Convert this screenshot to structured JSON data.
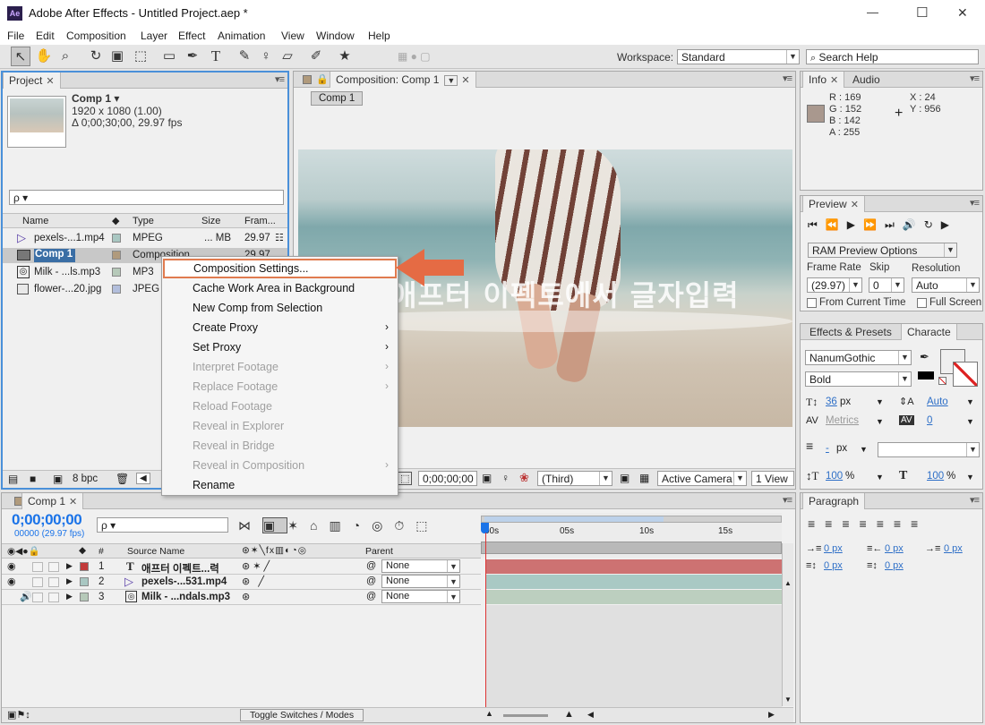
{
  "window": {
    "app_icon": "Ae",
    "title": "Adobe After Effects - Untitled Project.aep *",
    "controls": {
      "minimize": "—",
      "maximize": "☐",
      "close": "✕"
    }
  },
  "menubar": [
    "File",
    "Edit",
    "Composition",
    "Layer",
    "Effect",
    "Animation",
    "View",
    "Window",
    "Help"
  ],
  "toolbar": {
    "workspace_label": "Workspace:",
    "workspace_value": "Standard",
    "search_placeholder": "Search Help"
  },
  "project": {
    "tab": "Project",
    "comp_name": "Comp 1 ▾",
    "comp_size": "1920 x 1080 (1.00)",
    "comp_duration": "Δ 0;00;30;00, 29.97 fps",
    "search_value": "ρ ▾",
    "columns": {
      "name": "Name",
      "type": "Type",
      "size": "Size",
      "frame": "Fram..."
    },
    "items": [
      {
        "name": "pexels-...1.mp4",
        "type": "MPEG",
        "size": "... MB",
        "fps": "29.97",
        "color": "#a9c7c2",
        "icon": "video-icon"
      },
      {
        "name": "Comp 1",
        "type": "Composition",
        "size": "",
        "fps": "29.97",
        "color": "#b09a7c",
        "icon": "composition-icon"
      },
      {
        "name": "Milk - ...ls.mp3",
        "type": "MP3",
        "size": "",
        "fps": "",
        "color": "#b6c9b9",
        "icon": "audio-icon"
      },
      {
        "name": "flower-...20.jpg",
        "type": "JPEG",
        "size": "",
        "fps": "",
        "color": "#b2bedc",
        "icon": "image-icon"
      }
    ],
    "bpc": "8 bpc"
  },
  "context_menu": {
    "items": [
      {
        "label": "Composition Settings...",
        "enabled": true,
        "submenu": false,
        "highlighted": true
      },
      {
        "label": "Cache Work Area in Background",
        "enabled": true,
        "submenu": false
      },
      {
        "label": "New Comp from Selection",
        "enabled": true,
        "submenu": false
      },
      {
        "label": "Create Proxy",
        "enabled": true,
        "submenu": true
      },
      {
        "label": "Set Proxy",
        "enabled": true,
        "submenu": true
      },
      {
        "label": "Interpret Footage",
        "enabled": false,
        "submenu": true
      },
      {
        "label": "Replace Footage",
        "enabled": false,
        "submenu": true
      },
      {
        "label": "Reload Footage",
        "enabled": false,
        "submenu": false
      },
      {
        "label": "Reveal in Explorer",
        "enabled": false,
        "submenu": false
      },
      {
        "label": "Reveal in Bridge",
        "enabled": false,
        "submenu": false
      },
      {
        "label": "Reveal in Composition",
        "enabled": false,
        "submenu": true
      },
      {
        "label": "Rename",
        "enabled": true,
        "submenu": false
      }
    ],
    "submenu_arrow": "›"
  },
  "composition": {
    "tab": "Composition: Comp 1",
    "breadcrumb": "Comp 1",
    "overlay_text": "애프터 이펙트에서 글자입력",
    "bottom": {
      "timecode": "0;00;00;00",
      "resolution": "(Third)",
      "camera": "Active Camera",
      "views": "1 View"
    }
  },
  "info": {
    "tabs": [
      "Info",
      "Audio"
    ],
    "r": "R : 169",
    "g": "G : 152",
    "b": "B : 142",
    "a": "A : 255",
    "x": "X : 24",
    "y": "Y : 956",
    "swatch": "#a9988e"
  },
  "preview": {
    "tab": "Preview",
    "ram_options": "RAM Preview Options",
    "frame_rate_label": "Frame Rate",
    "skip_label": "Skip",
    "resolution_label": "Resolution",
    "frame_rate_value": "(29.97)",
    "skip_value": "0",
    "resolution_value": "Auto",
    "from_current": "From Current Time",
    "full_screen": "Full Screen"
  },
  "character": {
    "tabs": [
      "Effects & Presets",
      "Characte"
    ],
    "font": "NanumGothic",
    "style": "Bold",
    "size": "36",
    "size_unit": "px",
    "leading": "Auto",
    "kerning": "Metrics",
    "tracking": "0",
    "stroke": "-",
    "stroke_unit": "px",
    "vscale": "100",
    "hscale": "100",
    "pct": "%"
  },
  "paragraph": {
    "tab": "Paragraph",
    "indent_values": [
      "0 px",
      "0 px",
      "0 px",
      "0 px",
      "0 px"
    ]
  },
  "timeline": {
    "tab": "Comp 1",
    "timecode": "0;00;00;00",
    "frames": "00000 (29.97 fps)",
    "search_value": "ρ ▾",
    "headers": {
      "num": "#",
      "source": "Source Name",
      "parent": "Parent"
    },
    "ruler": [
      "00s",
      "05s",
      "10s",
      "15s"
    ],
    "layers": [
      {
        "num": "1",
        "name": "애프터 이펙트...력",
        "parent": "None",
        "color": "#c23b3b",
        "icon": "text-layer-icon",
        "bar": "#cd7272"
      },
      {
        "num": "2",
        "name": "pexels-...531.mp4",
        "parent": "None",
        "color": "#a9c7c2",
        "icon": "video-icon",
        "bar": "#a9c9c4"
      },
      {
        "num": "3",
        "name": "Milk - ...ndals.mp3",
        "parent": "None",
        "color": "#b6c9b9",
        "icon": "audio-icon",
        "bar": "#bccfbf"
      }
    ],
    "toggle_label": "Toggle Switches / Modes"
  }
}
